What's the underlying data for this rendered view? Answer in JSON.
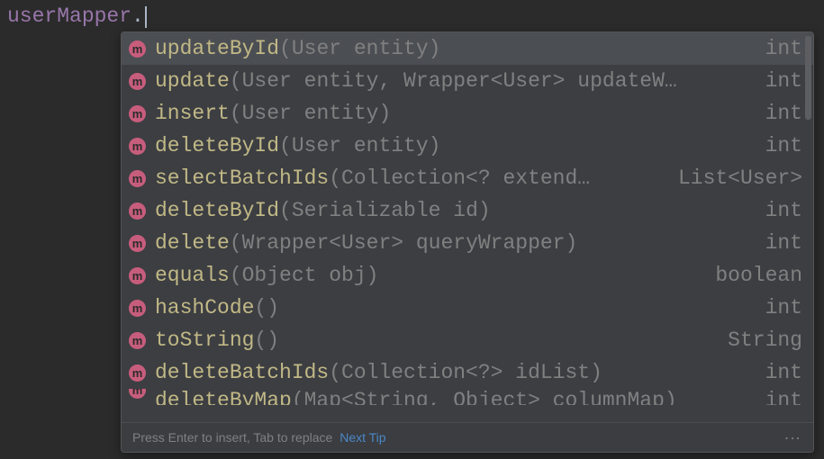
{
  "code": {
    "variable": "userMapper",
    "dot": "."
  },
  "completion": {
    "items": [
      {
        "name": "updateById",
        "params": "(User entity)",
        "returnType": "int",
        "selected": true
      },
      {
        "name": "update",
        "params": "(User entity, Wrapper<User> updateW…",
        "returnType": "int",
        "selected": false
      },
      {
        "name": "insert",
        "params": "(User entity)",
        "returnType": "int",
        "selected": false
      },
      {
        "name": "deleteById",
        "params": "(User entity)",
        "returnType": "int",
        "selected": false
      },
      {
        "name": "selectBatchIds",
        "params": "(Collection<? extend…",
        "returnType": "List<User>",
        "selected": false
      },
      {
        "name": "deleteById",
        "params": "(Serializable id)",
        "returnType": "int",
        "selected": false
      },
      {
        "name": "delete",
        "params": "(Wrapper<User> queryWrapper)",
        "returnType": "int",
        "selected": false
      },
      {
        "name": "equals",
        "params": "(Object obj)",
        "returnType": "boolean",
        "selected": false
      },
      {
        "name": "hashCode",
        "params": "()",
        "returnType": "int",
        "selected": false
      },
      {
        "name": "toString",
        "params": "()",
        "returnType": "String",
        "selected": false
      },
      {
        "name": "deleteBatchIds",
        "params": "(Collection<?> idList)",
        "returnType": "int",
        "selected": false
      },
      {
        "name": "deleteByMap",
        "params": "(Map<String, Object> columnMap)",
        "returnType": "int",
        "selected": false,
        "partial": true
      }
    ],
    "iconLabel": "m"
  },
  "footer": {
    "hint": "Press Enter to insert, Tab to replace",
    "nextTip": "Next Tip"
  }
}
